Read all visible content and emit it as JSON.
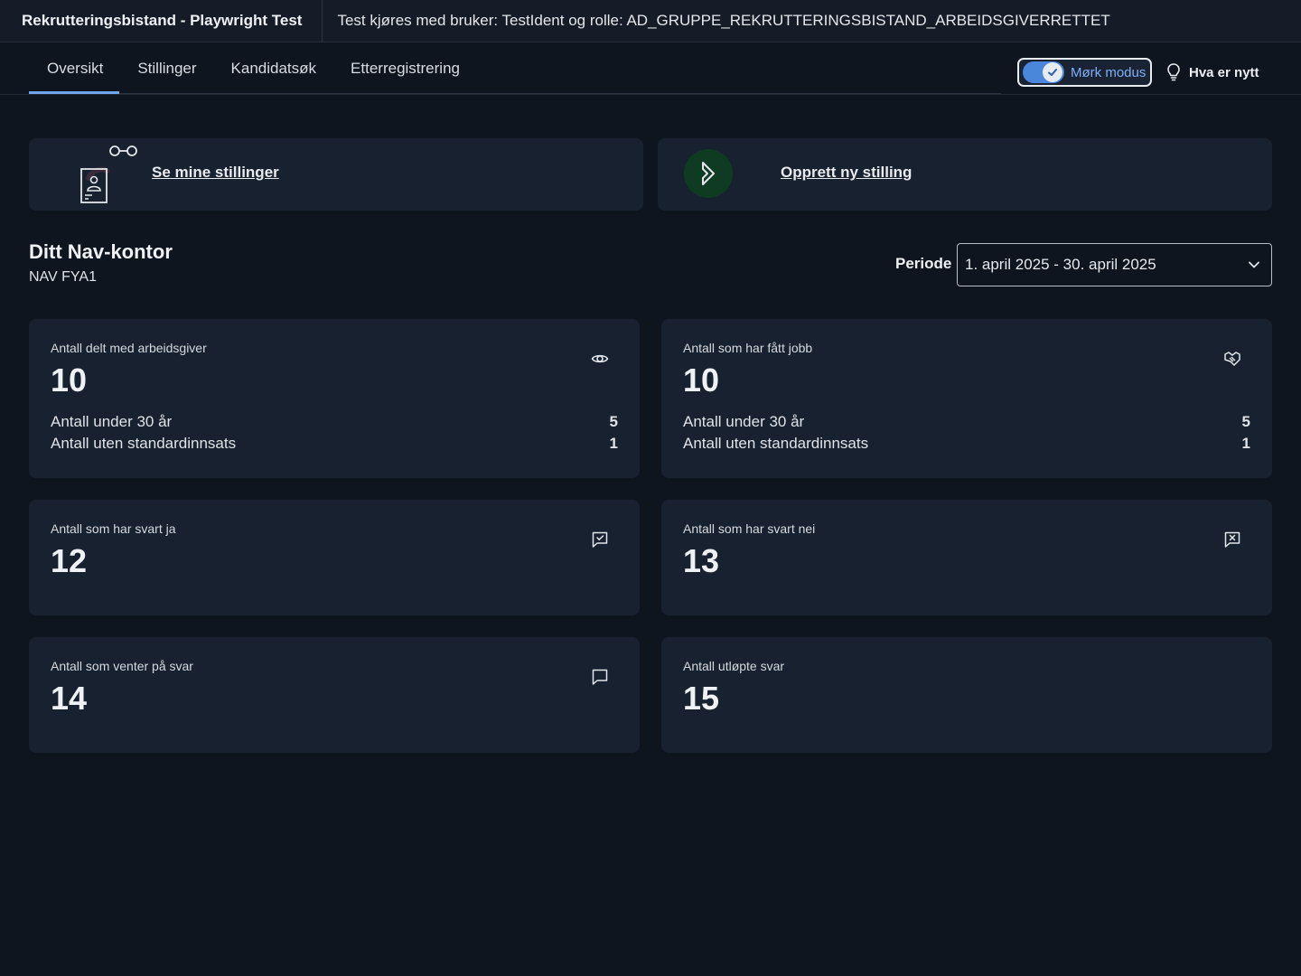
{
  "header": {
    "app_title": "Rekrutteringsbistand - Playwright Test",
    "test_info": "Test kjøres med bruker: TestIdent og rolle: AD_GRUPPE_REKRUTTERINGSBISTAND_ARBEIDSGIVERRETTET"
  },
  "nav": {
    "tabs": [
      {
        "label": "Oversikt",
        "active": true
      },
      {
        "label": "Stillinger",
        "active": false
      },
      {
        "label": "Kandidatsøk",
        "active": false
      },
      {
        "label": "Etterregistrering",
        "active": false
      }
    ],
    "dark_mode_label": "Mørk modus",
    "dark_mode_on": true,
    "whats_new_label": "Hva er nytt"
  },
  "links": {
    "my_positions": "Se mine stillinger",
    "create_position": "Opprett ny stilling"
  },
  "office": {
    "title": "Ditt Nav-kontor",
    "name": "NAV FYA1",
    "period_label": "Periode",
    "period_value": "1. april 2025 - 30. april 2025"
  },
  "stats": {
    "shared": {
      "label": "Antall delt med arbeidsgiver",
      "value": "10",
      "icon": "eye-icon",
      "rows": [
        {
          "label": "Antall under 30 år",
          "value": "5"
        },
        {
          "label": "Antall uten standardinnsats",
          "value": "1"
        }
      ]
    },
    "got_job": {
      "label": "Antall som har fått jobb",
      "value": "10",
      "icon": "handshake-icon",
      "rows": [
        {
          "label": "Antall under 30 år",
          "value": "5"
        },
        {
          "label": "Antall uten standardinnsats",
          "value": "1"
        }
      ]
    },
    "answered_yes": {
      "label": "Antall som har svart ja",
      "value": "12",
      "icon": "chat-check-icon"
    },
    "answered_no": {
      "label": "Antall som har svart nei",
      "value": "13",
      "icon": "chat-x-icon"
    },
    "waiting": {
      "label": "Antall som venter på svar",
      "value": "14",
      "icon": "chat-icon"
    },
    "expired": {
      "label": "Antall utløpte svar",
      "value": "15"
    }
  },
  "colors": {
    "background": "#0e151f",
    "card": "#182130",
    "accent": "#6ea4f0"
  }
}
